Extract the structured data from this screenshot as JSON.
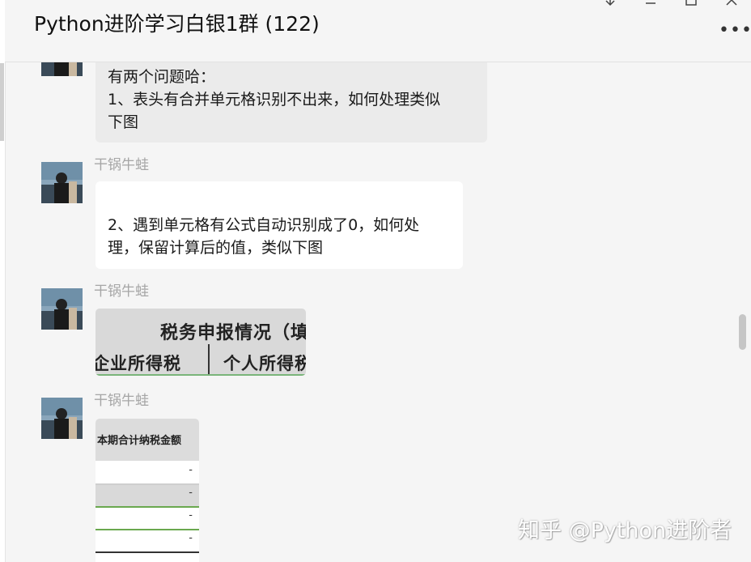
{
  "window": {
    "title": "Python进阶学习白银1群 (122)",
    "more_glyph": "•••"
  },
  "messages": [
    {
      "sender": "",
      "bubble_style": "gray",
      "lines": [
        "有两个问题哈：",
        "1、表头有合并单元格识别不出来，如何处理类似",
        "下图"
      ]
    },
    {
      "sender": "干锅牛蛙",
      "bubble_style": "white",
      "lines": [
        "2、遇到单元格有公式自动识别成了0，如何处",
        "理，保留计算后的值，类似下图"
      ]
    },
    {
      "sender": "干锅牛蛙",
      "image": {
        "title_fragment": "税务申报情况（填",
        "left_fragment": "企业所得税",
        "right_fragment": "个人所得税"
      }
    },
    {
      "sender": "干锅牛蛙",
      "image": {
        "header": "本期合计纳税金额",
        "rows": [
          "-",
          "-",
          "-",
          "-"
        ]
      }
    }
  ],
  "watermark": "知乎 @Python进阶者",
  "colors": {
    "background": "#f5f5f5",
    "bubble_gray": "#ebebeb",
    "bubble_white": "#ffffff",
    "sender_name": "#a6a6a6",
    "table_green_line": "#6aa84f"
  }
}
